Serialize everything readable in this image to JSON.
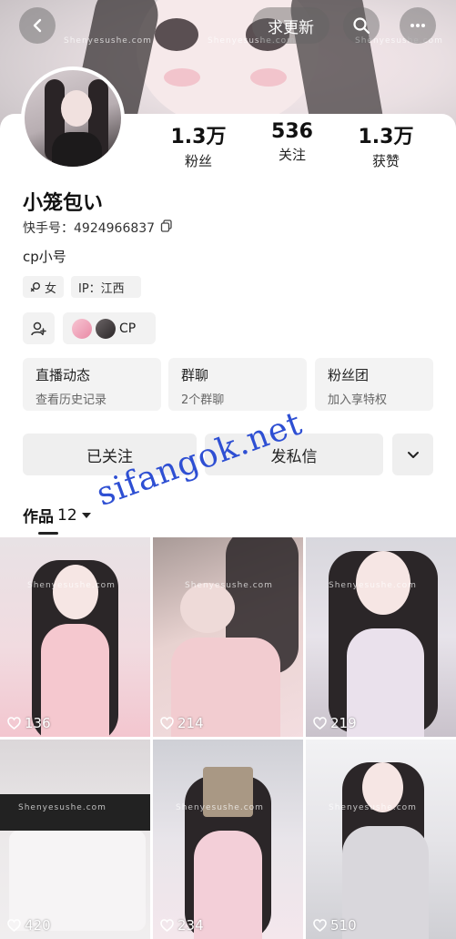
{
  "header": {
    "back_icon": "chevron-left-icon",
    "update_button": "求更新",
    "search_icon": "search-icon",
    "more_icon": "more-dots-icon",
    "watermark": "Shenyesushe.com"
  },
  "profile": {
    "name": "小笼包い",
    "kuaishou_id_label": "快手号：",
    "kuaishou_id": "4924966837",
    "bio": "cp小号",
    "gender_tag": "女",
    "ip_tag": "IP：江西",
    "cp_label": "CP"
  },
  "stats": [
    {
      "value": "1.3万",
      "label": "粉丝"
    },
    {
      "value": "536",
      "label": "关注"
    },
    {
      "value": "1.3万",
      "label": "获赞"
    }
  ],
  "cards": [
    {
      "title": "直播动态",
      "subtitle": "查看历史记录"
    },
    {
      "title": "群聊",
      "subtitle": "2个群聊"
    },
    {
      "title": "粉丝团",
      "subtitle": "加入享特权"
    }
  ],
  "actions": {
    "followed": "已关注",
    "message": "发私信"
  },
  "works": {
    "label": "作品",
    "count": "12"
  },
  "promo_watermark": "sifangok.net",
  "videos": [
    {
      "likes": "136"
    },
    {
      "likes": "214"
    },
    {
      "likes": "219"
    },
    {
      "likes": "420"
    },
    {
      "likes": "234"
    },
    {
      "likes": "510"
    }
  ]
}
